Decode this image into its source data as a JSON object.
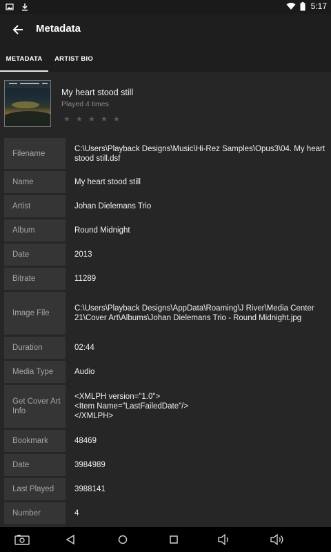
{
  "status": {
    "time": "5:17",
    "icons": [
      "image-icon",
      "download-icon",
      "wifi-icon",
      "battery-icon"
    ]
  },
  "appbar": {
    "title": "Metadata"
  },
  "tabs": [
    {
      "label": "METADATA",
      "active": true
    },
    {
      "label": "ARTIST BIO",
      "active": false
    }
  ],
  "track": {
    "title": "My heart stood still",
    "played": "Played 4 times",
    "rating": 0,
    "rating_max": 5
  },
  "metadata": [
    {
      "label": "Filename",
      "value": "C:\\Users\\Playback Designs\\Music\\Hi-Rez Samples\\Opus3\\04. My heart stood still.dsf"
    },
    {
      "label": "Name",
      "value": "My heart stood still"
    },
    {
      "label": "Artist",
      "value": "Johan Dielemans Trio"
    },
    {
      "label": "Album",
      "value": "Round Midnight"
    },
    {
      "label": "Date",
      "value": "2013"
    },
    {
      "label": "Bitrate",
      "value": "11289"
    },
    {
      "label": "Image File",
      "value": "C:\\Users\\Playback Designs\\AppData\\Roaming\\J River\\Media Center 21\\Cover Art\\Albums\\Johan Dielemans Trio - Round Midnight.jpg"
    },
    {
      "label": "Duration",
      "value": "02:44"
    },
    {
      "label": "Media Type",
      "value": "Audio"
    },
    {
      "label": "Get Cover Art Info",
      "value": "<XMLPH version=\"1.0\">\n<Item Name=\"LastFailedDate\"/>\n</XMLPH>"
    },
    {
      "label": "Bookmark",
      "value": "48469"
    },
    {
      "label": "Date",
      "value": "3984989"
    },
    {
      "label": "Last Played",
      "value": "3988141"
    },
    {
      "label": "Number",
      "value": "4"
    },
    {
      "label": "",
      "value": ""
    }
  ],
  "navbar": {
    "icons": [
      "screenshot-icon",
      "back-icon",
      "home-icon",
      "recents-icon",
      "volume-down-icon",
      "volume-up-icon"
    ]
  }
}
